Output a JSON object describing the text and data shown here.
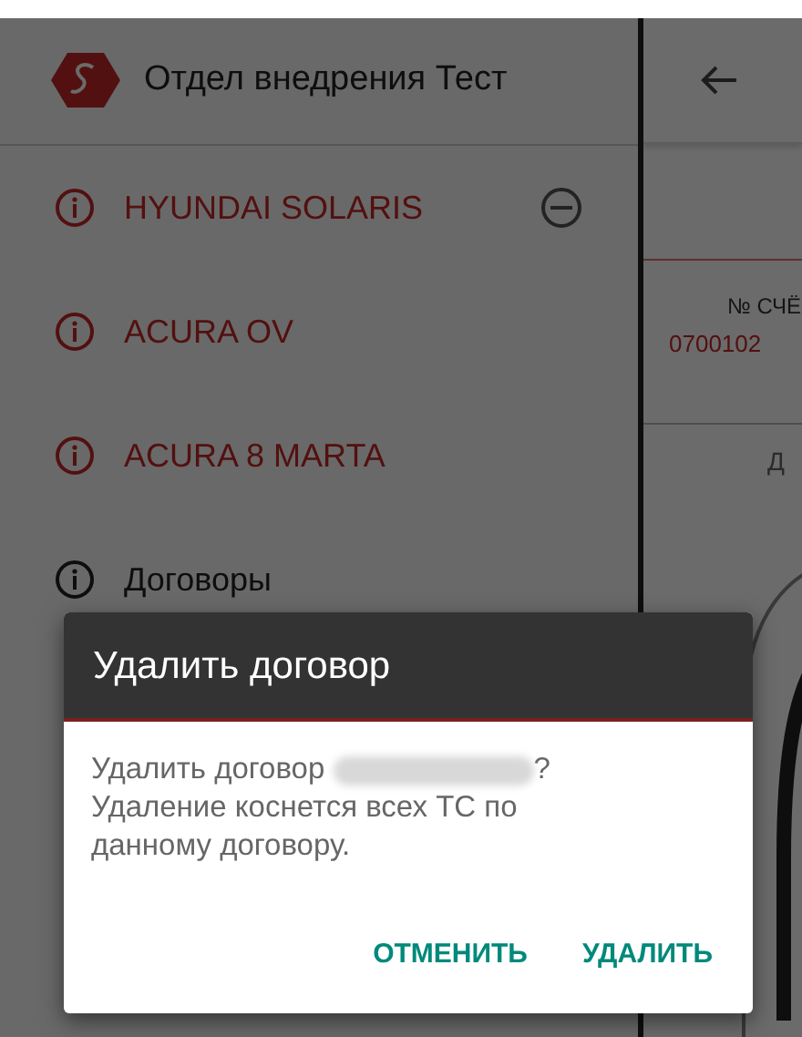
{
  "drawer": {
    "title": "Отдел внедрения Тест",
    "items": [
      {
        "label": "HYUNDAI SOLARIS",
        "kind": "vehicle",
        "removable": true
      },
      {
        "label": "ACURA OV",
        "kind": "vehicle",
        "removable": false
      },
      {
        "label": "ACURA 8 MARTA",
        "kind": "vehicle",
        "removable": false
      },
      {
        "label": "Договоры",
        "kind": "section",
        "removable": false
      }
    ]
  },
  "screen": {
    "field_label": "№ СЧЁ",
    "field_value": "0700102",
    "section_label": "Д"
  },
  "dialog": {
    "title": "Удалить договор",
    "message_before": "Удалить договор",
    "message_after": "?\nУдаление коснется всех ТС по данному договору.",
    "buttons": [
      "ОТМЕНИТЬ",
      "УДАЛИТЬ"
    ]
  }
}
